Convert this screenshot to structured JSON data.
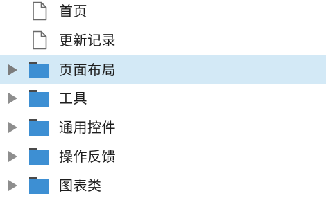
{
  "tree": {
    "items": [
      {
        "label": "首页",
        "type": "file",
        "icon": "file-icon"
      },
      {
        "label": "更新记录",
        "type": "file",
        "icon": "file-icon"
      },
      {
        "label": "页面布局",
        "type": "folder",
        "icon": "folder-icon",
        "selected": true
      },
      {
        "label": "工具",
        "type": "folder",
        "icon": "folder-icon"
      },
      {
        "label": "通用控件",
        "type": "folder",
        "icon": "folder-icon"
      },
      {
        "label": "操作反馈",
        "type": "folder",
        "icon": "folder-icon"
      },
      {
        "label": "图表类",
        "type": "folder",
        "icon": "folder-icon"
      }
    ],
    "colors": {
      "selected_bg": "#d3e9f6",
      "folder": "#3d8fd3",
      "folder_tab": "#4a4a4a",
      "arrow": "#8e8e8e",
      "text": "#1e1e1e"
    }
  }
}
